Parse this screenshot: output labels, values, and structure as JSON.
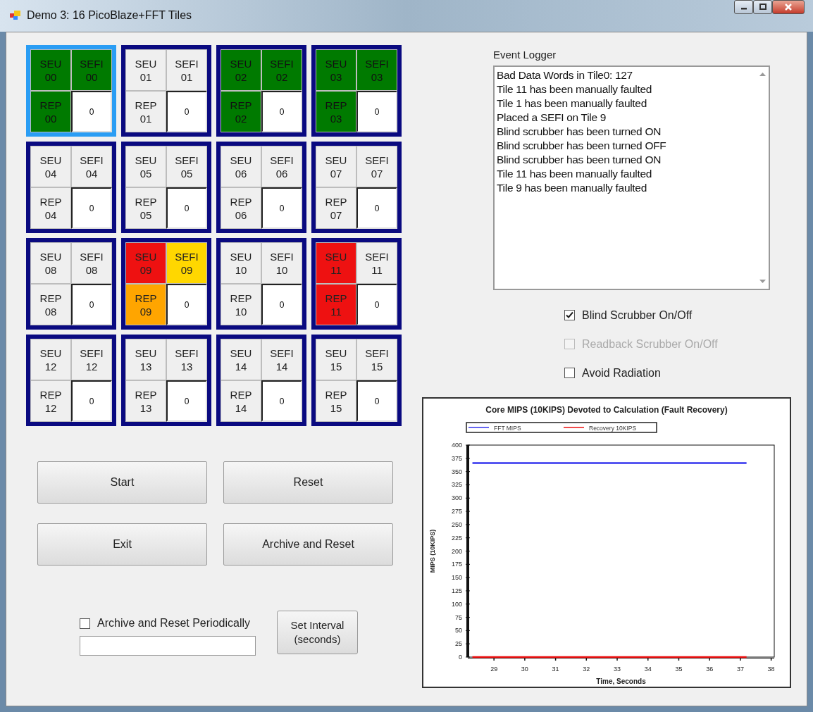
{
  "window": {
    "title": "Demo 3: 16 PicoBlaze+FFT Tiles"
  },
  "tiles": [
    {
      "selected": true,
      "seu": {
        "label": "SEU\n00",
        "color": "#007a00"
      },
      "sefi": {
        "label": "SEFI\n00",
        "color": "#007a00"
      },
      "rep": {
        "label": "REP\n00",
        "color": "#007a00"
      },
      "count": "0"
    },
    {
      "selected": false,
      "seu": {
        "label": "SEU\n01",
        "color": "#efefef"
      },
      "sefi": {
        "label": "SEFI\n01",
        "color": "#efefef"
      },
      "rep": {
        "label": "REP\n01",
        "color": "#efefef"
      },
      "count": "0"
    },
    {
      "selected": false,
      "seu": {
        "label": "SEU\n02",
        "color": "#007a00"
      },
      "sefi": {
        "label": "SEFI\n02",
        "color": "#007a00"
      },
      "rep": {
        "label": "REP\n02",
        "color": "#007a00"
      },
      "count": "0"
    },
    {
      "selected": false,
      "seu": {
        "label": "SEU\n03",
        "color": "#007a00"
      },
      "sefi": {
        "label": "SEFI\n03",
        "color": "#007a00"
      },
      "rep": {
        "label": "REP\n03",
        "color": "#007a00"
      },
      "count": "0"
    },
    {
      "selected": false,
      "seu": {
        "label": "SEU\n04",
        "color": "#efefef"
      },
      "sefi": {
        "label": "SEFI\n04",
        "color": "#efefef"
      },
      "rep": {
        "label": "REP\n04",
        "color": "#efefef"
      },
      "count": "0"
    },
    {
      "selected": false,
      "seu": {
        "label": "SEU\n05",
        "color": "#efefef"
      },
      "sefi": {
        "label": "SEFI\n05",
        "color": "#efefef"
      },
      "rep": {
        "label": "REP\n05",
        "color": "#efefef"
      },
      "count": "0"
    },
    {
      "selected": false,
      "seu": {
        "label": "SEU\n06",
        "color": "#efefef"
      },
      "sefi": {
        "label": "SEFI\n06",
        "color": "#efefef"
      },
      "rep": {
        "label": "REP\n06",
        "color": "#efefef"
      },
      "count": "0"
    },
    {
      "selected": false,
      "seu": {
        "label": "SEU\n07",
        "color": "#efefef"
      },
      "sefi": {
        "label": "SEFI\n07",
        "color": "#efefef"
      },
      "rep": {
        "label": "REP\n07",
        "color": "#efefef"
      },
      "count": "0"
    },
    {
      "selected": false,
      "seu": {
        "label": "SEU\n08",
        "color": "#efefef"
      },
      "sefi": {
        "label": "SEFI\n08",
        "color": "#efefef"
      },
      "rep": {
        "label": "REP\n08",
        "color": "#efefef"
      },
      "count": "0"
    },
    {
      "selected": false,
      "seu": {
        "label": "SEU\n09",
        "color": "#ee1111"
      },
      "sefi": {
        "label": "SEFI\n09",
        "color": "#ffd700"
      },
      "rep": {
        "label": "REP\n09",
        "color": "#ffa500"
      },
      "count": "0"
    },
    {
      "selected": false,
      "seu": {
        "label": "SEU\n10",
        "color": "#efefef"
      },
      "sefi": {
        "label": "SEFI\n10",
        "color": "#efefef"
      },
      "rep": {
        "label": "REP\n10",
        "color": "#efefef"
      },
      "count": "0"
    },
    {
      "selected": false,
      "seu": {
        "label": "SEU\n11",
        "color": "#ee1111"
      },
      "sefi": {
        "label": "SEFI\n11",
        "color": "#efefef"
      },
      "rep": {
        "label": "REP\n11",
        "color": "#ee1111"
      },
      "count": "0"
    },
    {
      "selected": false,
      "seu": {
        "label": "SEU\n12",
        "color": "#efefef"
      },
      "sefi": {
        "label": "SEFI\n12",
        "color": "#efefef"
      },
      "rep": {
        "label": "REP\n12",
        "color": "#efefef"
      },
      "count": "0"
    },
    {
      "selected": false,
      "seu": {
        "label": "SEU\n13",
        "color": "#efefef"
      },
      "sefi": {
        "label": "SEFI\n13",
        "color": "#efefef"
      },
      "rep": {
        "label": "REP\n13",
        "color": "#efefef"
      },
      "count": "0"
    },
    {
      "selected": false,
      "seu": {
        "label": "SEU\n14",
        "color": "#efefef"
      },
      "sefi": {
        "label": "SEFI\n14",
        "color": "#efefef"
      },
      "rep": {
        "label": "REP\n14",
        "color": "#efefef"
      },
      "count": "0"
    },
    {
      "selected": false,
      "seu": {
        "label": "SEU\n15",
        "color": "#efefef"
      },
      "sefi": {
        "label": "SEFI\n15",
        "color": "#efefef"
      },
      "rep": {
        "label": "REP\n15",
        "color": "#efefef"
      },
      "count": "0"
    }
  ],
  "buttons": [
    "Start",
    "Reset",
    "Exit",
    "Archive and Reset"
  ],
  "periodic": {
    "label": "Archive and Reset Periodically",
    "checked": false,
    "button": "Set Interval\n(seconds)"
  },
  "event_logger": {
    "label": "Event Logger",
    "lines": [
      "Bad Data Words in Tile0: 127",
      "Tile 11 has been manually faulted",
      "Tile 1 has been manually faulted",
      "Placed a SEFI on Tile 9",
      "Blind scrubber has been turned ON",
      "Blind scrubber has been turned OFF",
      "Blind scrubber has been turned ON",
      "Tile 11 has been manually faulted",
      "Tile 9 has been manually faulted"
    ]
  },
  "options": [
    {
      "label": "Blind Scrubber On/Off",
      "checked": true,
      "disabled": false
    },
    {
      "label": "Readback Scrubber On/Off",
      "checked": false,
      "disabled": true
    },
    {
      "label": "Avoid Radiation",
      "checked": false,
      "disabled": false
    }
  ],
  "chart": {
    "chart_data": {
      "type": "line",
      "title": "Core MIPS (10KIPS) Devoted to Calculation (Fault Recovery)",
      "xlabel": "Time, Seconds",
      "ylabel": "MIPS (10KIPS)",
      "x": [
        28.3,
        37.2
      ],
      "legend": "top",
      "series": [
        {
          "name": "FFT MIPS",
          "color": "#3333ee",
          "values": [
            366,
            366
          ]
        },
        {
          "name": "Recovery 10KIPS",
          "color": "#ee1111",
          "values": [
            0,
            0
          ]
        }
      ],
      "xlim": [
        28.15,
        38.1
      ],
      "ylim": [
        0,
        400
      ],
      "xticks": [
        29,
        30,
        31,
        32,
        33,
        34,
        35,
        36,
        37,
        38
      ],
      "yticks": [
        0,
        25,
        50,
        75,
        100,
        125,
        150,
        175,
        200,
        225,
        250,
        275,
        300,
        325,
        350,
        375,
        400
      ]
    }
  }
}
